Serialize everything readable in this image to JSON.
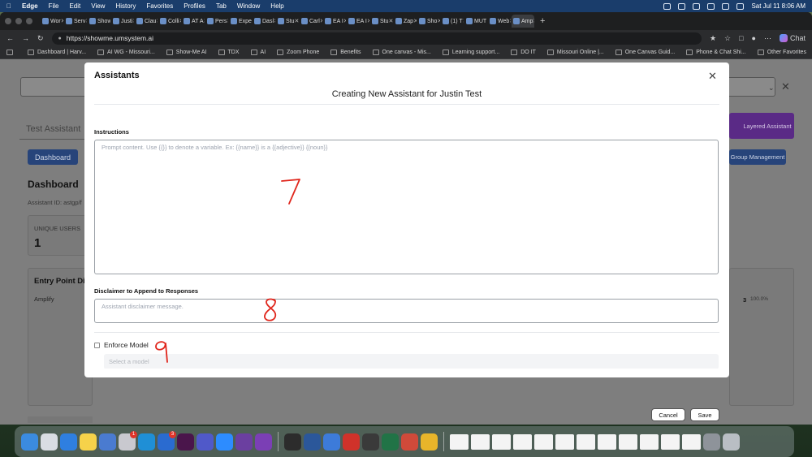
{
  "menubar": {
    "app": "Edge",
    "items": [
      "File",
      "Edit",
      "View",
      "History",
      "Favorites",
      "Profiles",
      "Tab",
      "Window",
      "Help"
    ],
    "datetime": "Sat Jul 11  8:06 AM"
  },
  "tabs": [
    "Wor",
    "Serv",
    "Show",
    "Justi",
    "Clau",
    "Colli",
    "AT A",
    "Pers",
    "Expe",
    "Dasl",
    "Stu",
    "Carl",
    "EA I",
    "EA I",
    "Stu",
    "Zap",
    "Sho",
    "(1) T",
    "MUT",
    "Web",
    "Amp"
  ],
  "browser": {
    "url": "https://showme.umsystem.ai",
    "copilot_label": "Chat"
  },
  "bookmarks": [
    "Dashboard | Harv...",
    "AI WG - Missouri...",
    "Show-Me AI",
    "TDX",
    "AI",
    "Zoom Phone",
    "Benefits",
    "One canvas - Mis...",
    "Learning support...",
    "DO IT",
    "Missouri Online |...",
    "One Canvas Guid...",
    "Phone & Chat Shi..."
  ],
  "bookmarks_right": "Other Favorites",
  "background_page": {
    "tab_label": "Test Assistant",
    "dashboard_button": "Dashboard",
    "heading": "Dashboard",
    "assistant_id": "Assistant ID: astgp/f",
    "unique_users_label": "UNIQUE USERS",
    "unique_users_value": "1",
    "entry_point_heading": "Entry Point Di",
    "entry_point_row": "Amplify",
    "entry_count": "3",
    "entry_percent": "100.0%",
    "layered_assistant": "Layered Assistant",
    "group_management": "Group Management"
  },
  "modal": {
    "title": "Assistants",
    "subtitle": "Creating New Assistant for Justin Test",
    "instructions_label": "Instructions",
    "instructions_placeholder": "Prompt content. Use {{}} to denote a variable. Ex: {{name}} is a {{adjective}} {{noun}}",
    "disclaimer_label": "Disclaimer to Append to Responses",
    "disclaimer_placeholder": "Assistant disclaimer message.",
    "enforce_model_label": "Enforce Model",
    "model_select_placeholder": "Select a model",
    "cancel_label": "Cancel",
    "save_label": "Save"
  },
  "annotations": [
    "7",
    "8",
    "9"
  ],
  "annotation_color": "#e0261c",
  "dock_badges": [
    "1",
    "3"
  ]
}
